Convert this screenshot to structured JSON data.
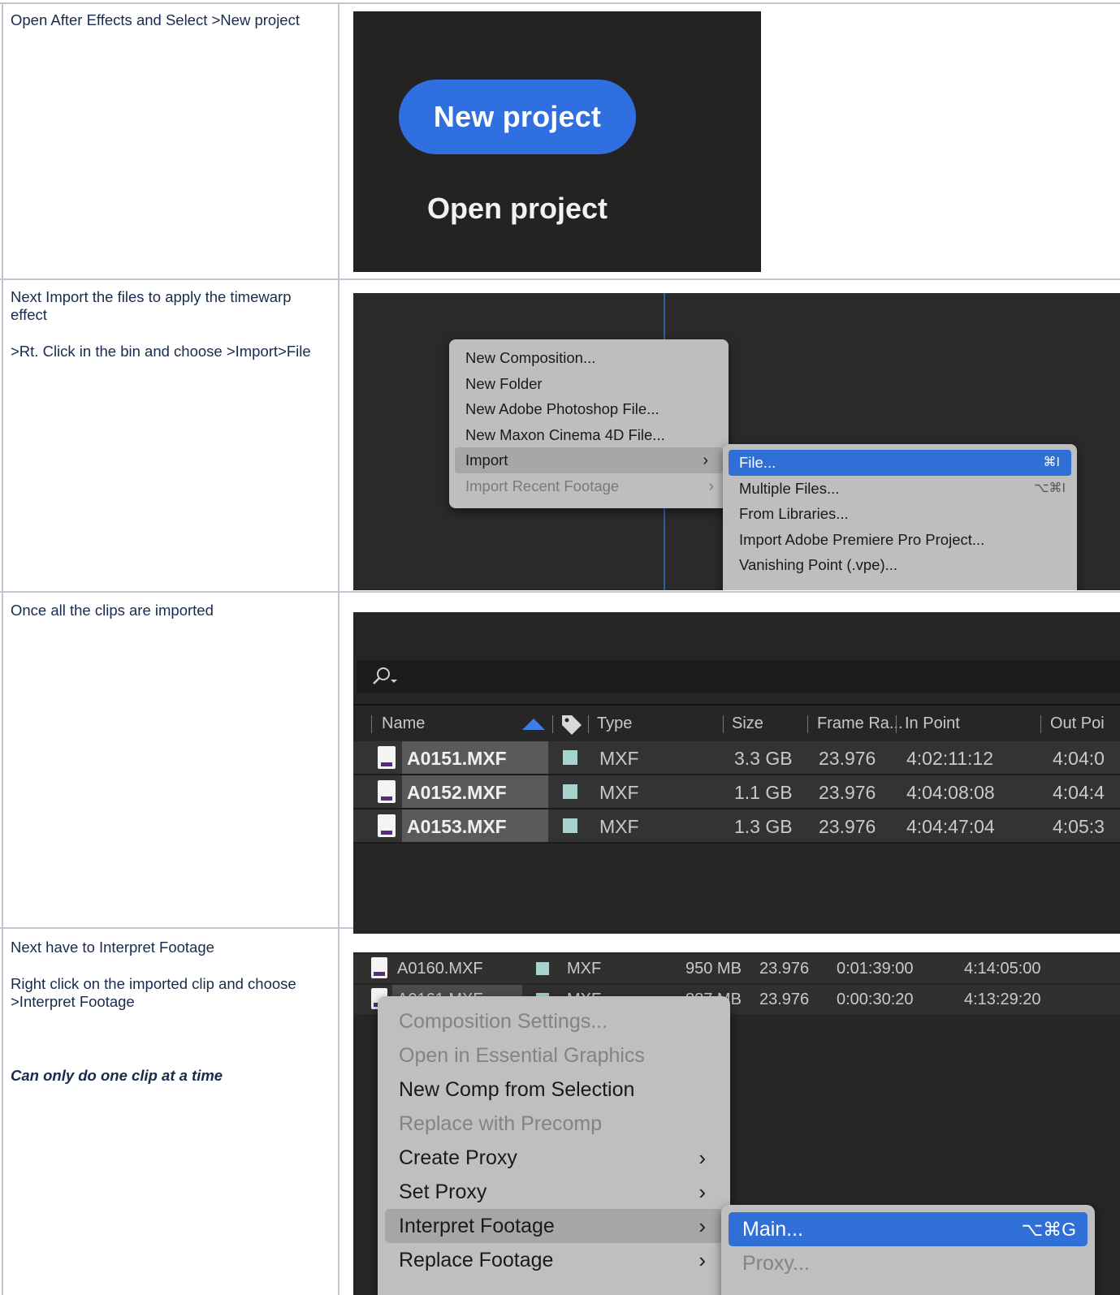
{
  "rows": [
    {
      "instructions": [
        "Open After Effects and Select >New project"
      ],
      "shot": {
        "new_project_label": "New project",
        "open_project_label": "Open project"
      }
    },
    {
      "instructions": [
        "Next Import the files to apply the timewarp",
        "effect",
        ">Rt. Click in the bin and choose >Import>File"
      ],
      "shot": {
        "menu": [
          "New Composition...",
          "New Folder",
          "New Adobe Photoshop File...",
          "New Maxon Cinema 4D File...",
          "Import",
          "Import Recent Footage"
        ],
        "submenu": [
          {
            "label": "File...",
            "shortcut": "⌘I"
          },
          {
            "label": "Multiple Files...",
            "shortcut": "⌥⌘I"
          },
          {
            "label": "From Libraries...",
            "shortcut": ""
          },
          {
            "label": "Import Adobe Premiere Pro Project...",
            "shortcut": ""
          },
          {
            "label": "Vanishing Point (.vpe)...",
            "shortcut": ""
          }
        ],
        "arrow": "›"
      }
    },
    {
      "instructions": [
        "Once all the clips are imported"
      ],
      "shot": {
        "columns": [
          "Name",
          "Type",
          "Size",
          "Frame Ra...",
          "In Point",
          "Out Poi"
        ],
        "clips": [
          {
            "name": "A0151.MXF",
            "type": "MXF",
            "size": "3.3 GB",
            "frame_rate": "23.976",
            "in_point": "4:02:11:12",
            "out_point": "4:04:0"
          },
          {
            "name": "A0152.MXF",
            "type": "MXF",
            "size": "1.1 GB",
            "frame_rate": "23.976",
            "in_point": "4:04:08:08",
            "out_point": "4:04:4"
          },
          {
            "name": "A0153.MXF",
            "type": "MXF",
            "size": "1.3 GB",
            "frame_rate": "23.976",
            "in_point": "4:04:47:04",
            "out_point": "4:05:3"
          }
        ]
      }
    },
    {
      "instructions": [
        "Next have to Interpret Footage",
        "Right click on the imported clip and choose",
        ">Interpret Footage",
        "Can only do one clip at a time"
      ],
      "shot": {
        "clips": [
          {
            "name": "A0160.MXF",
            "type": "MXF",
            "size": "950 MB",
            "frame_rate": "23.976",
            "duration": "0:01:39:00",
            "out_point": "4:14:05:00"
          },
          {
            "name": "A0161.MXF",
            "type": "MXF",
            "size": "887 MB",
            "frame_rate": "23.976",
            "duration": "0:00:30:20",
            "out_point": "4:13:29:20"
          }
        ],
        "menu": [
          "Composition Settings...",
          "Open in Essential Graphics",
          "New Comp from Selection",
          "Replace with Precomp",
          "Create Proxy",
          "Set Proxy",
          "Interpret Footage",
          "Replace Footage"
        ],
        "submenu": [
          {
            "label": "Main...",
            "shortcut": "⌥⌘G"
          },
          {
            "label": "Proxy...",
            "shortcut": ""
          }
        ]
      }
    }
  ],
  "colors": {
    "accent_blue": "#2f6fe0",
    "swatch": "#a7d3cf"
  },
  "icons": [
    "search-icon",
    "tag-icon",
    "sort-up-icon",
    "file-icon",
    "chevron-right-icon"
  ]
}
